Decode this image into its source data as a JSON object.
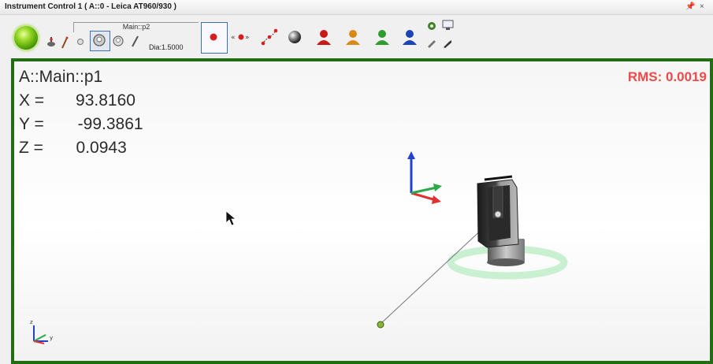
{
  "window": {
    "title": "Instrument Control 1 ( A::0 - Leica AT960/930 )",
    "pin_glyph": "↕",
    "close_glyph": "×"
  },
  "toolbar": {
    "status_led_color": "#5dbb17",
    "target_group": "Main::p2",
    "diameter": "Dia:1.5000",
    "icons": [
      "status-led-icon",
      "probe-stand-icon",
      "probe-stick-icon",
      "small-sphere-icon",
      "sphere-target-icon",
      "sphere-target-alt-icon",
      "pen-probe-icon",
      "measure-point-icon",
      "shoot-point-icon",
      "path-measure-icon",
      "ball-icon",
      "user-red-icon",
      "user-orange-icon",
      "user-green-icon",
      "user-blue-icon",
      "settings-gear-icon",
      "screen-icon",
      "wrench-icon",
      "tool-icon"
    ]
  },
  "readout": {
    "point_name": "A::Main::p1",
    "x_label": "X =",
    "x_value": "93.8160",
    "y_label": "Y =",
    "y_value": "-99.3861",
    "z_label": "Z =",
    "z_value": "0.0943"
  },
  "rms": {
    "label": "RMS: 0.0019"
  },
  "axis_mini": {
    "z": "z",
    "y": "y"
  },
  "colors": {
    "viewport_border": "#236d14",
    "rms": "#ee4a4a",
    "axis_x": "#e03030",
    "axis_y": "#2aa84a",
    "axis_z": "#2244cc",
    "ring": "#c9f0d0"
  }
}
